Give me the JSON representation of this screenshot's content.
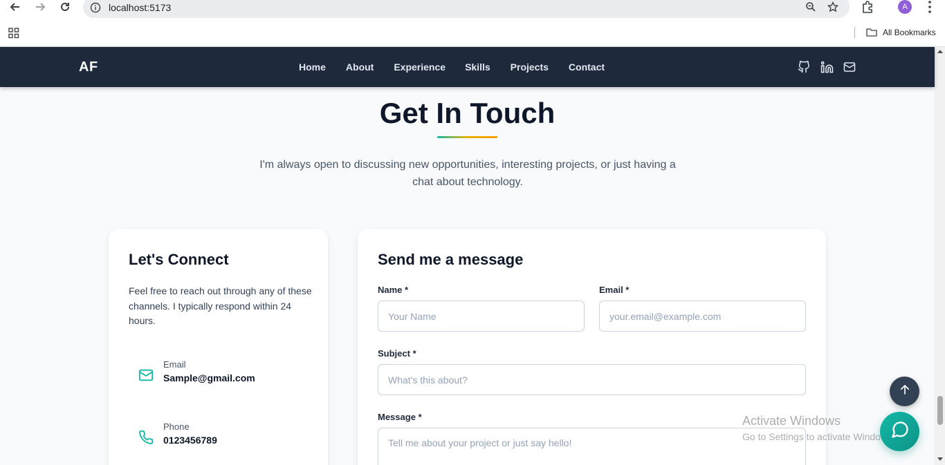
{
  "browser": {
    "url": "localhost:5173",
    "profile_initial": "A",
    "bookmarks_label": "All Bookmarks"
  },
  "site": {
    "logo": "AF",
    "nav": [
      "Home",
      "About",
      "Experience",
      "Skills",
      "Projects",
      "Contact"
    ],
    "social_icons": [
      "github-icon",
      "linkedin-icon",
      "mail-icon"
    ]
  },
  "contact": {
    "heading": "Get In Touch",
    "intro": "I'm always open to discussing new opportunities, interesting projects, or just having a chat about technology.",
    "connect": {
      "title": "Let's Connect",
      "description": "Feel free to reach out through any of these channels. I typically respond within 24 hours.",
      "items": [
        {
          "label": "Email",
          "value": "Sample@gmail.com",
          "icon": "mail-icon"
        },
        {
          "label": "Phone",
          "value": "0123456789",
          "icon": "phone-icon"
        }
      ]
    },
    "form": {
      "title": "Send me a message",
      "name_label": "Name *",
      "name_placeholder": "Your Name",
      "email_label": "Email *",
      "email_placeholder": "your.email@example.com",
      "subject_label": "Subject *",
      "subject_placeholder": "What's this about?",
      "message_label": "Message *",
      "message_placeholder": "Tell me about your project or just say hello!"
    }
  },
  "watermark": {
    "title": "Activate Windows",
    "subtitle": "Go to Settings to activate Windows."
  },
  "colors": {
    "nav_bg": "#1e293b",
    "accent": "#14b8a6",
    "page_bg": "#f8fafc"
  }
}
